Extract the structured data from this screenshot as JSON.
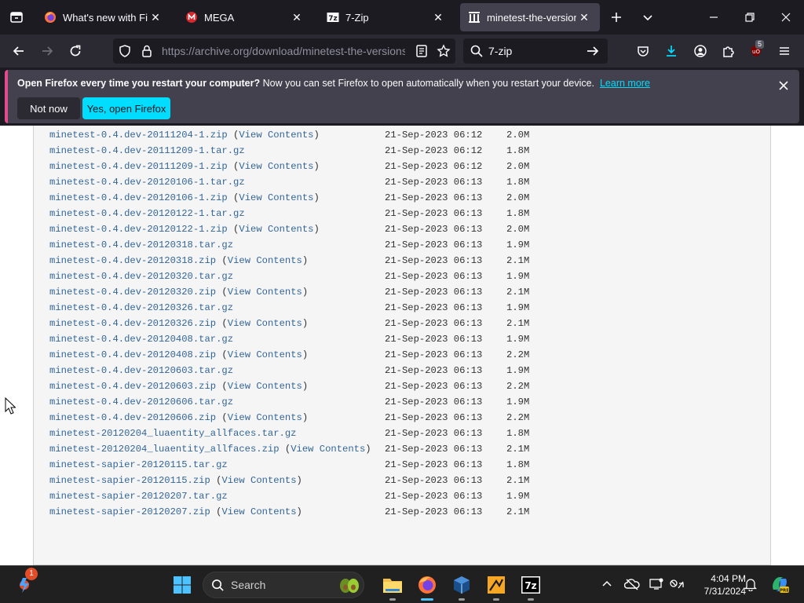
{
  "browser": {
    "tabs": [
      {
        "label": "What's new with Firefox"
      },
      {
        "label": "MEGA"
      },
      {
        "label": "7-Zip"
      },
      {
        "label": "minetest-the-versions"
      }
    ],
    "url_text": "https://archive.org/download/minetest-the-versions",
    "search_query": "7-zip",
    "extensions_badge": "5"
  },
  "notification": {
    "bold_text": "Open Firefox every time you restart your computer?",
    "body_text": " Now you can set Firefox to open automatically when you restart your device.",
    "learn_more": "Learn more",
    "not_now": "Not now",
    "yes_open": "Yes, open Firefox"
  },
  "listing": {
    "rows": [
      {
        "name": "minetest-0.4.dev-20111204-1.zip",
        "view": "View Contents",
        "date": "21-Sep-2023 06:12",
        "size": "2.0M"
      },
      {
        "name": "minetest-0.4.dev-20111209-1.tar.gz",
        "view": "",
        "date": "21-Sep-2023 06:12",
        "size": "1.8M"
      },
      {
        "name": "minetest-0.4.dev-20111209-1.zip",
        "view": "View Contents",
        "date": "21-Sep-2023 06:12",
        "size": "2.0M"
      },
      {
        "name": "minetest-0.4.dev-20120106-1.tar.gz",
        "view": "",
        "date": "21-Sep-2023 06:13",
        "size": "1.8M"
      },
      {
        "name": "minetest-0.4.dev-20120106-1.zip",
        "view": "View Contents",
        "date": "21-Sep-2023 06:13",
        "size": "2.0M"
      },
      {
        "name": "minetest-0.4.dev-20120122-1.tar.gz",
        "view": "",
        "date": "21-Sep-2023 06:13",
        "size": "1.8M"
      },
      {
        "name": "minetest-0.4.dev-20120122-1.zip",
        "view": "View Contents",
        "date": "21-Sep-2023 06:13",
        "size": "2.0M"
      },
      {
        "name": "minetest-0.4.dev-20120318.tar.gz",
        "view": "",
        "date": "21-Sep-2023 06:13",
        "size": "1.9M"
      },
      {
        "name": "minetest-0.4.dev-20120318.zip",
        "view": "View Contents",
        "date": "21-Sep-2023 06:13",
        "size": "2.1M"
      },
      {
        "name": "minetest-0.4.dev-20120320.tar.gz",
        "view": "",
        "date": "21-Sep-2023 06:13",
        "size": "1.9M"
      },
      {
        "name": "minetest-0.4.dev-20120320.zip",
        "view": "View Contents",
        "date": "21-Sep-2023 06:13",
        "size": "2.1M"
      },
      {
        "name": "minetest-0.4.dev-20120326.tar.gz",
        "view": "",
        "date": "21-Sep-2023 06:13",
        "size": "1.9M"
      },
      {
        "name": "minetest-0.4.dev-20120326.zip",
        "view": "View Contents",
        "date": "21-Sep-2023 06:13",
        "size": "2.1M"
      },
      {
        "name": "minetest-0.4.dev-20120408.tar.gz",
        "view": "",
        "date": "21-Sep-2023 06:13",
        "size": "1.9M"
      },
      {
        "name": "minetest-0.4.dev-20120408.zip",
        "view": "View Contents",
        "date": "21-Sep-2023 06:13",
        "size": "2.2M"
      },
      {
        "name": "minetest-0.4.dev-20120603.tar.gz",
        "view": "",
        "date": "21-Sep-2023 06:13",
        "size": "1.9M"
      },
      {
        "name": "minetest-0.4.dev-20120603.zip",
        "view": "View Contents",
        "date": "21-Sep-2023 06:13",
        "size": "2.2M"
      },
      {
        "name": "minetest-0.4.dev-20120606.tar.gz",
        "view": "",
        "date": "21-Sep-2023 06:13",
        "size": "1.9M"
      },
      {
        "name": "minetest-0.4.dev-20120606.zip",
        "view": "View Contents",
        "date": "21-Sep-2023 06:13",
        "size": "2.2M"
      },
      {
        "name": "minetest-20120204_luaentity_allfaces.tar.gz",
        "view": "",
        "date": "21-Sep-2023 06:13",
        "size": "1.8M"
      },
      {
        "name": "minetest-20120204_luaentity_allfaces.zip",
        "view": "View Contents",
        "date": "21-Sep-2023 06:13",
        "size": "2.1M"
      },
      {
        "name": "minetest-sapier-20120115.tar.gz",
        "view": "",
        "date": "21-Sep-2023 06:13",
        "size": "1.8M"
      },
      {
        "name": "minetest-sapier-20120115.zip",
        "view": "View Contents",
        "date": "21-Sep-2023 06:13",
        "size": "2.1M"
      },
      {
        "name": "minetest-sapier-20120207.tar.gz",
        "view": "",
        "date": "21-Sep-2023 06:13",
        "size": "1.9M"
      },
      {
        "name": "minetest-sapier-20120207.zip",
        "view": "View Contents",
        "date": "21-Sep-2023 06:13",
        "size": "2.1M"
      }
    ]
  },
  "taskbar": {
    "search_label": "Search",
    "widget_badge": "1",
    "time": "4:04 PM",
    "date": "7/31/2024"
  },
  "colors": {
    "link": "#336699",
    "accent": "#00ddff",
    "notice_border": "#e24b8e"
  }
}
